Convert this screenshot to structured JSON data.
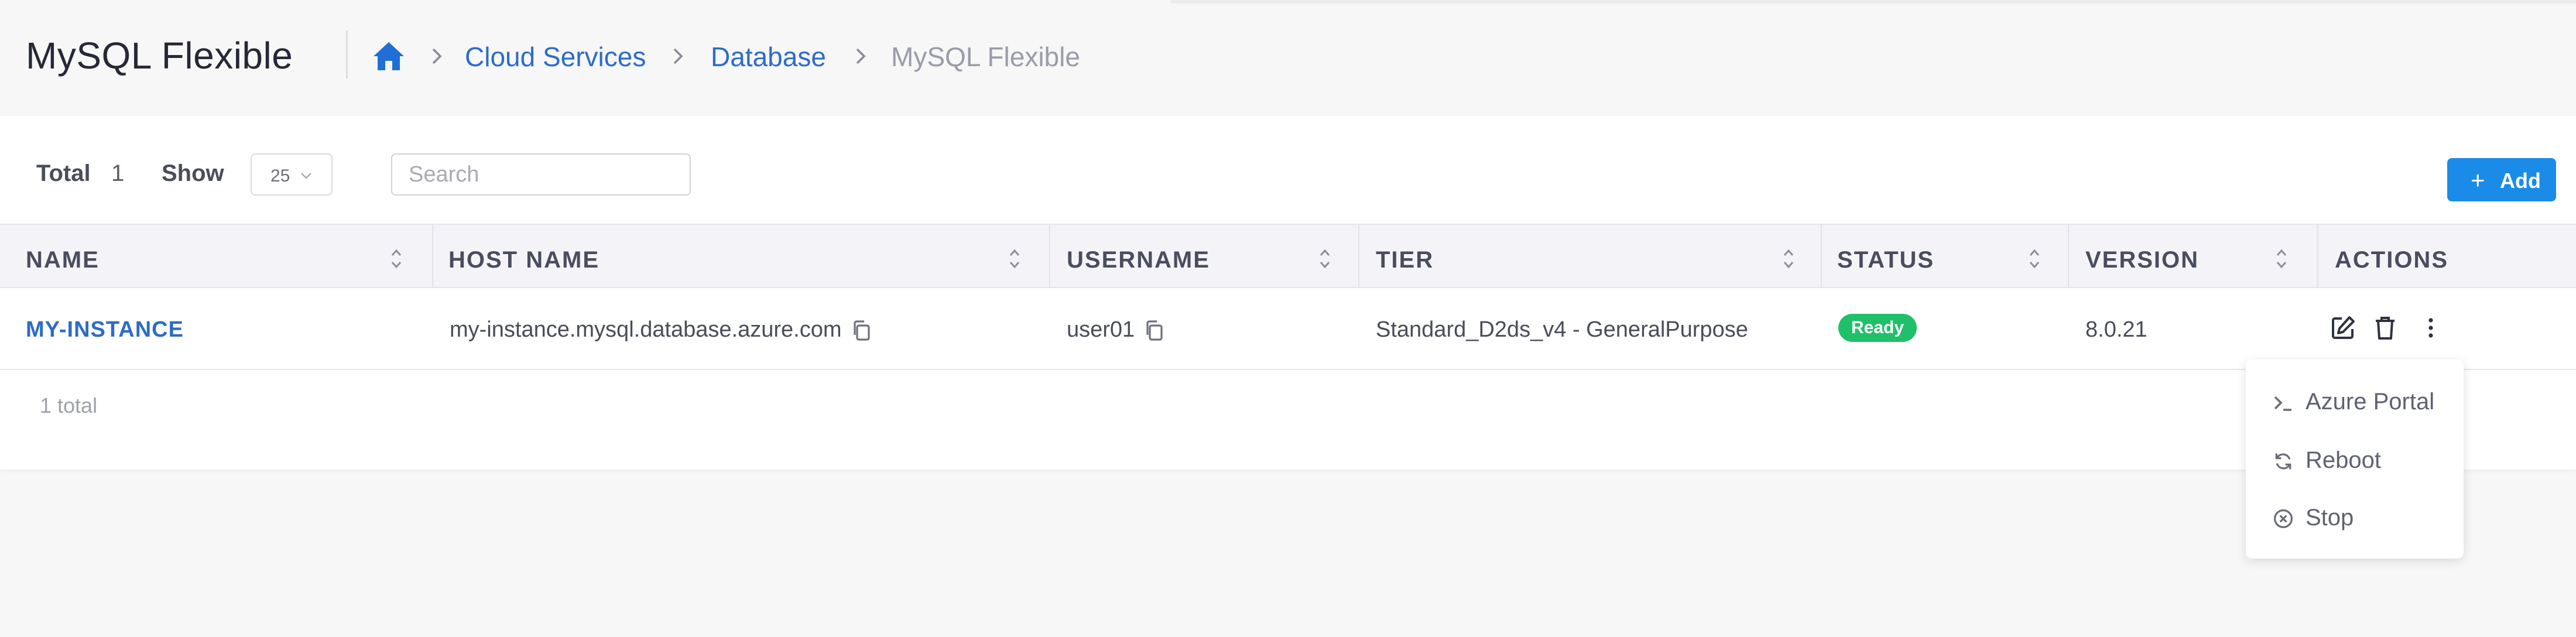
{
  "header": {
    "title": "MySQL Flexible",
    "breadcrumb": [
      "Cloud Services",
      "Database",
      "MySQL Flexible"
    ]
  },
  "toolbar": {
    "total_label": "Total",
    "total_value": "1",
    "show_label": "Show",
    "page_size": "25",
    "search_placeholder": "Search",
    "add_label": "Add",
    "add_icon": "+"
  },
  "table": {
    "columns": [
      "NAME",
      "HOST NAME",
      "USERNAME",
      "TIER",
      "STATUS",
      "VERSION",
      "ACTIONS"
    ],
    "rows": [
      {
        "name": "MY-INSTANCE",
        "host": "my-instance.mysql.database.azure.com",
        "username": "user01",
        "tier": "Standard_D2ds_v4 - GeneralPurpose",
        "status": "Ready",
        "version": "8.0.21"
      }
    ],
    "footer_total": "1 total"
  },
  "actions_menu": [
    {
      "label": "Azure Portal",
      "icon": "terminal-icon"
    },
    {
      "label": "Reboot",
      "icon": "refresh-icon"
    },
    {
      "label": "Stop",
      "icon": "stop-circle-icon"
    }
  ],
  "colors": {
    "accent": "#1a8ce8",
    "link": "#2d6cc6",
    "status_ready": "#1fc069"
  }
}
